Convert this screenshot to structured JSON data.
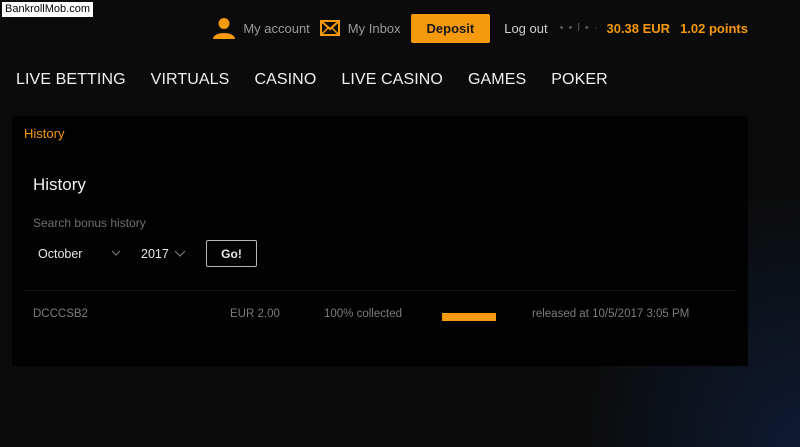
{
  "watermark": "BankrollMob.com",
  "header": {
    "my_account": "My account",
    "my_inbox": "My Inbox",
    "deposit": "Deposit",
    "logout": "Log out",
    "username": "• • l • ·",
    "balance": "30.38 EUR",
    "points": "1.02 points"
  },
  "nav": [
    "LIVE BETTING",
    "VIRTUALS",
    "CASINO",
    "LIVE CASINO",
    "GAMES",
    "POKER"
  ],
  "breadcrumb": "History",
  "page_title": "History",
  "search": {
    "label": "Search bonus history",
    "month": "October",
    "year": "2017",
    "go_label": "Go!"
  },
  "history_rows": [
    {
      "code": "DCCCSB2",
      "amount": "EUR 2.00",
      "status": "100% collected",
      "progress": 1.0,
      "released": "released at 10/5/2017 3:05 PM"
    }
  ],
  "colors": {
    "accent": "#f59a0c",
    "background": "#0b0b0b",
    "panel": "#020202"
  },
  "icons": {
    "account": "user-icon",
    "inbox": "envelope-icon",
    "dropdown": "chevron-down-icon"
  }
}
